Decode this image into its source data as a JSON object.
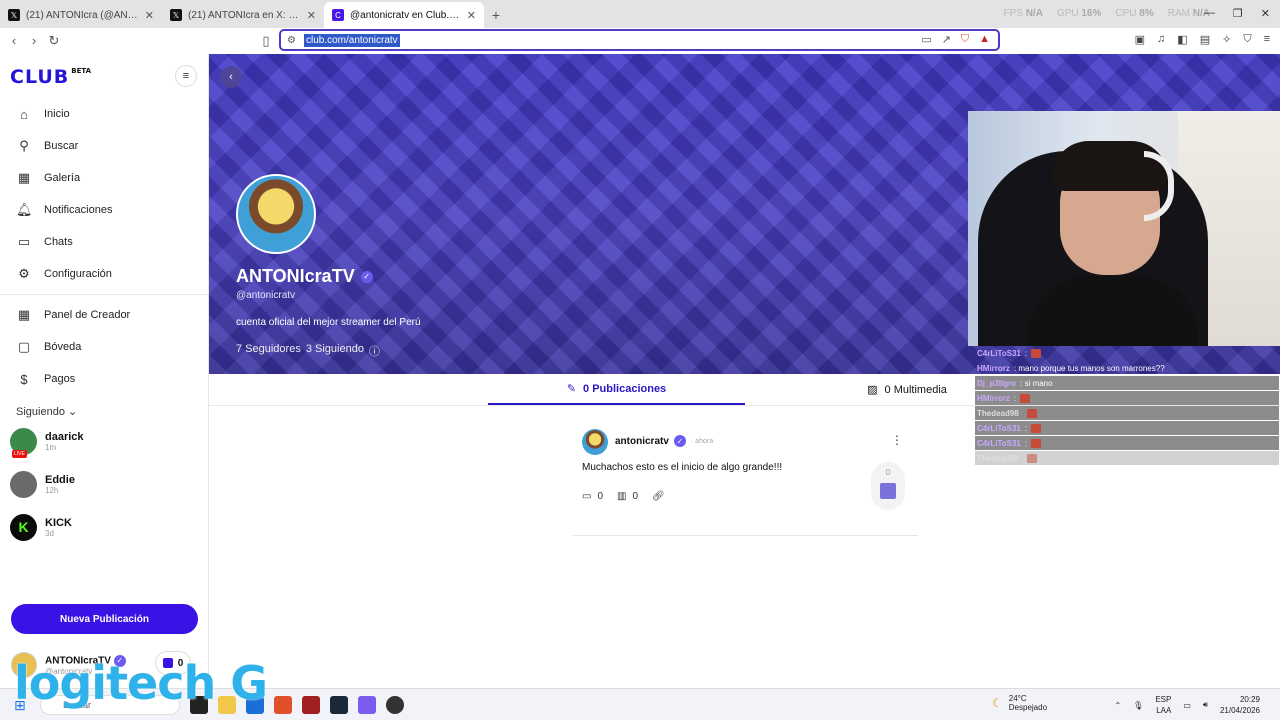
{
  "browser": {
    "tabs": [
      {
        "title": "(21) ANTONIcra (@AN7HONY1811) / X",
        "icon": "x-logo"
      },
      {
        "title": "(21) ANTONIcra en X: \"Muchachos esto es",
        "icon": "x-logo"
      },
      {
        "title": "@antonicratv en Club.com",
        "icon": "club-logo"
      }
    ],
    "stats": {
      "fps_label": "FPS",
      "fps": "N/A",
      "gpu_label": "GPU",
      "gpu": "16%",
      "cpu_label": "CPU",
      "cpu": "8%",
      "ram_label": "RAM",
      "ram": "N/A"
    },
    "url": "club.com/antonicratv"
  },
  "sidebar": {
    "logo": "CLUB",
    "logo_badge": "BETA",
    "nav": [
      {
        "label": "Inicio",
        "icon": "home-icon"
      },
      {
        "label": "Buscar",
        "icon": "search-icon"
      },
      {
        "label": "Galería",
        "icon": "gallery-icon"
      },
      {
        "label": "Notificaciones",
        "icon": "bell-icon"
      },
      {
        "label": "Chats",
        "icon": "chat-icon"
      },
      {
        "label": "Configuración",
        "icon": "gear-icon"
      }
    ],
    "nav2": [
      {
        "label": "Panel de Creador",
        "icon": "dashboard-icon"
      },
      {
        "label": "Bóveda",
        "icon": "vault-icon"
      },
      {
        "label": "Pagos",
        "icon": "dollar-icon"
      }
    ],
    "following_label": "Siguiendo",
    "following": [
      {
        "name": "daarick",
        "sub": "1m",
        "live": "LIVE"
      },
      {
        "name": "Eddie",
        "sub": "12h"
      },
      {
        "name": "KICK",
        "sub": "3d"
      }
    ],
    "new_post": "Nueva Publicación",
    "me": {
      "name": "ANTONIcraTV",
      "handle": "@antonicratv",
      "count": "0"
    }
  },
  "profile": {
    "name": "ANTONIcraTV",
    "handle": "@antonicratv",
    "bio": "cuenta oficial del mejor streamer del Perú",
    "followers": "7 Seguidores",
    "following": "3 Siguiendo"
  },
  "feed": {
    "tabs": [
      {
        "label": "0 Publicaciones",
        "icon": "pencil-icon"
      },
      {
        "label": "0 Multimedia",
        "icon": "image-icon"
      }
    ],
    "post": {
      "author": "antonicratv",
      "time": "· ahora",
      "text": "Muchachos esto es el inicio de algo grande!!!",
      "comments": "0",
      "views": "0",
      "votes": "0"
    }
  },
  "stream_chat": [
    {
      "user": "C4rLiToS31",
      "msg": ":"
    },
    {
      "user": "HMirrorz",
      "msg": ": mano porque tus manos son marrones??"
    },
    {
      "user": "Dj_p3llgro",
      "msg": ": si mano"
    },
    {
      "user": "HMirrorz",
      "msg": ":"
    },
    {
      "user": "Thedead98",
      "msg": ""
    },
    {
      "user": "C4rLiToS31",
      "msg": ":"
    },
    {
      "user": "C4rLiToS31",
      "msg": ":"
    },
    {
      "user": "Thedead98",
      "msg": ""
    }
  ],
  "taskbar": {
    "search": "Buscar",
    "weather_temp": "24°C",
    "weather_desc": "Despejado",
    "lang": "ESP",
    "lang2": "LAA",
    "time": "20:29",
    "date": "21/04/2026"
  },
  "watermark": "logitech G"
}
